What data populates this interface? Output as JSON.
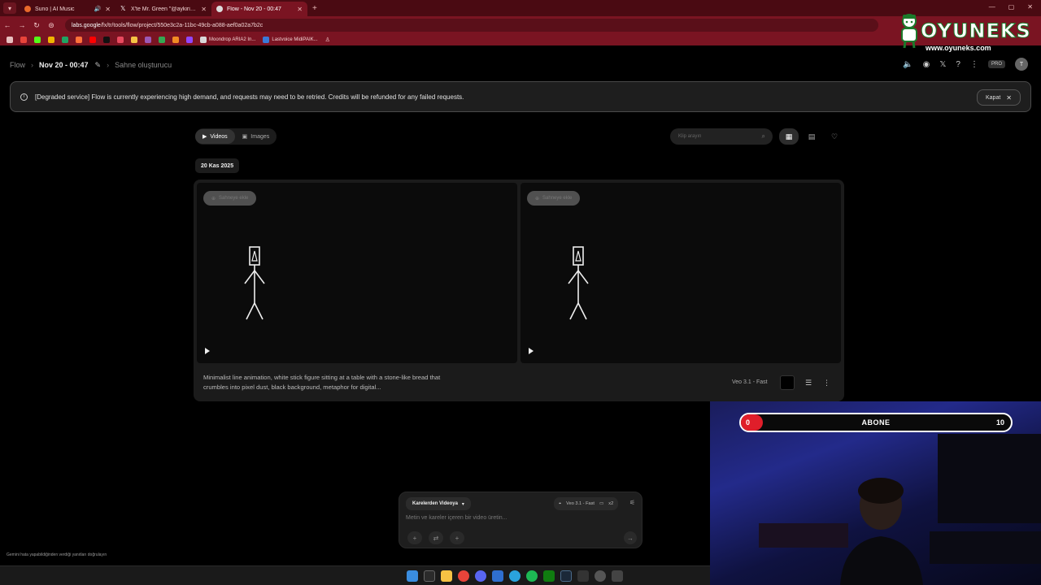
{
  "browser": {
    "tabs": [
      {
        "title": "Suno | AI Music",
        "color": "#e86a2b",
        "audio": true,
        "active": false
      },
      {
        "title": "X'te Mr. Green \"@aykiricomtr: ...",
        "color": "#ffffff",
        "audio": false,
        "active": false
      },
      {
        "title": "Flow - Nov 20 - 00:47",
        "color": "#e0e0e0",
        "audio": false,
        "active": true
      }
    ],
    "url_host": "labs.google",
    "url_path": "/fx/tr/tools/flow/project/550e3c2a-11bc-49cb-a088-aef0a02a7b2c",
    "bookmarks": [
      {
        "label": "Moondrop ARIA2 In...",
        "color": "#d8d8d8"
      },
      {
        "label": "Lastvoice MidiPAIK...",
        "color": "#3a7ad8"
      }
    ]
  },
  "logo": {
    "name": "OYUNEKS",
    "url": "www.oyuneks.com"
  },
  "app": {
    "breadcrumb": {
      "root": "Flow",
      "project": "Nov 20 - 00:47",
      "scene": "Sahne oluşturucu"
    },
    "header": {
      "pro": "PRO",
      "avatar": "T"
    },
    "banner": {
      "message": "[Degraded service] Flow is currently experiencing high demand, and requests may need to be retried. Credits will be refunded for any failed requests.",
      "close_label": "Kapat"
    },
    "toolbar": {
      "videos_label": "Videos",
      "images_label": "Images",
      "search_placeholder": "Klip arayın"
    },
    "date_label": "20 Kas 2025",
    "card": {
      "chip_left": "Sahneye ekle",
      "chip_right": "Sahneye ekle",
      "prompt": "Minimalist line animation, white stick figure sitting at a table with a stone-like bread that crumbles into pixel dust, black background, metaphor for digital...",
      "model": "Veo 3.1 - Fast"
    },
    "composer": {
      "mode": "Karelerden Videoya",
      "model": "Veo 3.1 - Fast",
      "count": "x2",
      "placeholder": "Metin ve kareler içeren bir video üretin..."
    },
    "disclaimer": "Gemini hata yapabildiğinden verdiği yanıtları doğrulayın"
  },
  "webcam": {
    "sub_label": "ABONE",
    "sub_min": "0",
    "sub_max": "10",
    "sub_progress": 0.08,
    "accent": "#e01e2a"
  }
}
